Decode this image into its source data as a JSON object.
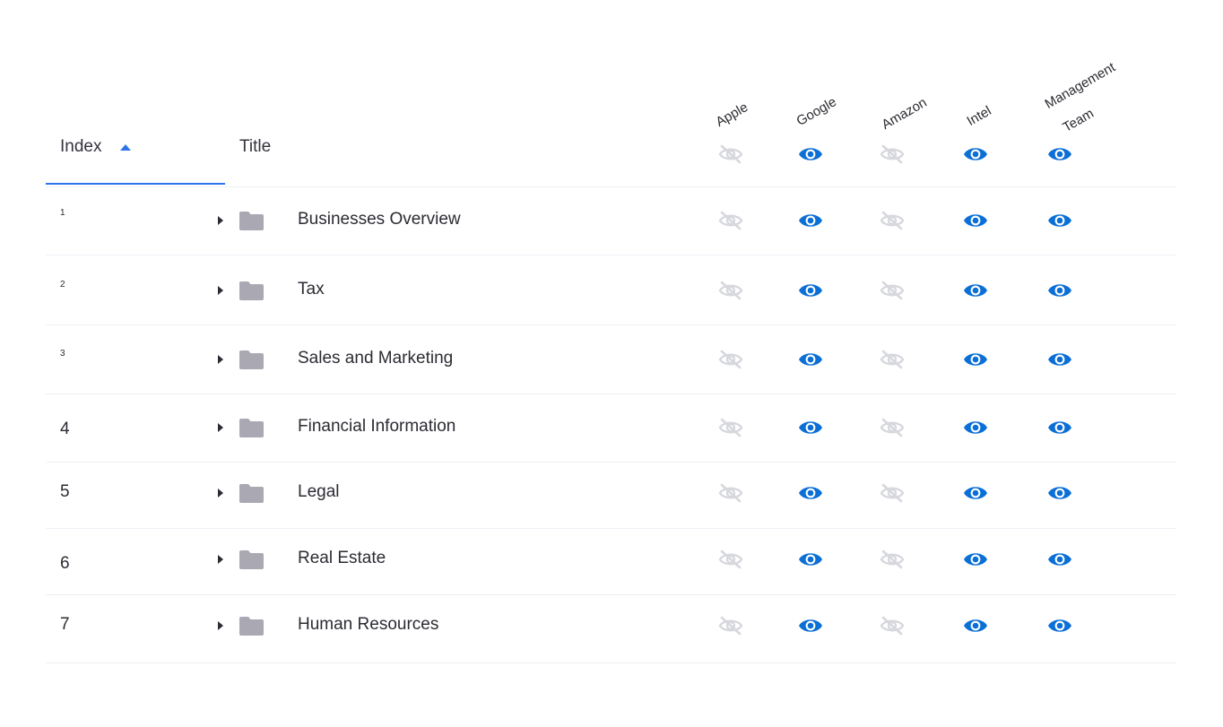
{
  "header": {
    "index_label": "Index",
    "title_label": "Title",
    "sort_direction": "ascending",
    "columns": [
      {
        "name": "Apple",
        "default_visible": false
      },
      {
        "name": "Google",
        "default_visible": true
      },
      {
        "name": "Amazon",
        "default_visible": false
      },
      {
        "name": "Intel",
        "default_visible": true
      },
      {
        "name_line1": "Management",
        "name_line2": "Team",
        "default_visible": true
      }
    ]
  },
  "rows": [
    {
      "index": "1",
      "title": "Businesses Overview",
      "visibility": [
        false,
        true,
        false,
        true,
        true
      ]
    },
    {
      "index": "2",
      "title": "Tax",
      "visibility": [
        false,
        true,
        false,
        true,
        true
      ]
    },
    {
      "index": "3",
      "title": "Sales and Marketing",
      "visibility": [
        false,
        true,
        false,
        true,
        true
      ]
    },
    {
      "index": "4",
      "title": "Financial Information",
      "visibility": [
        false,
        true,
        false,
        true,
        true
      ]
    },
    {
      "index": "5",
      "title": "Legal",
      "visibility": [
        false,
        true,
        false,
        true,
        true
      ]
    },
    {
      "index": "6",
      "title": "Real Estate",
      "visibility": [
        false,
        true,
        false,
        true,
        true
      ]
    },
    {
      "index": "7",
      "title": "Human Resources",
      "visibility": [
        false,
        true,
        false,
        true,
        true
      ]
    }
  ],
  "icons": {
    "visible": "eye-icon",
    "hidden": "eye-off-icon",
    "folder": "folder-icon",
    "expand": "caret-right-icon",
    "sort": "sort-up-icon"
  },
  "colors": {
    "accent": "#2f74ea",
    "eye_visible": "#0b6fd6",
    "eye_hidden": "#d7d8de",
    "folder": "#a9a8b3",
    "divider": "#eef0f6"
  }
}
